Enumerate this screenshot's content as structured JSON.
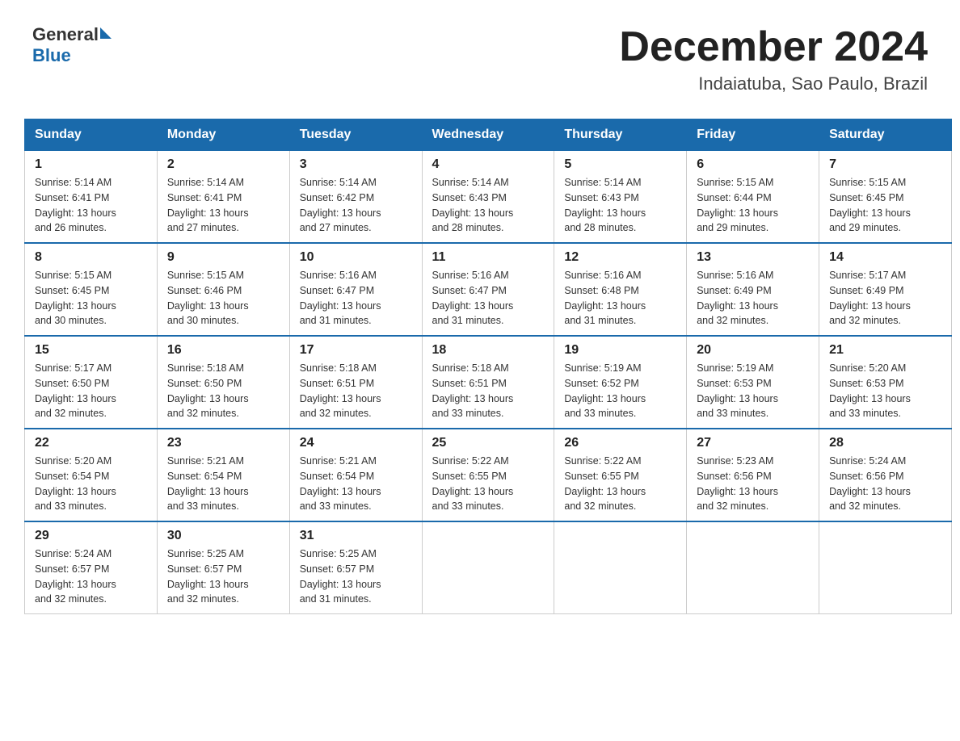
{
  "header": {
    "logo_general": "General",
    "logo_blue": "Blue",
    "month_title": "December 2024",
    "location": "Indaiatuba, Sao Paulo, Brazil"
  },
  "weekdays": [
    "Sunday",
    "Monday",
    "Tuesday",
    "Wednesday",
    "Thursday",
    "Friday",
    "Saturday"
  ],
  "weeks": [
    [
      {
        "day": "1",
        "sunrise": "5:14 AM",
        "sunset": "6:41 PM",
        "daylight": "13 hours and 26 minutes."
      },
      {
        "day": "2",
        "sunrise": "5:14 AM",
        "sunset": "6:41 PM",
        "daylight": "13 hours and 27 minutes."
      },
      {
        "day": "3",
        "sunrise": "5:14 AM",
        "sunset": "6:42 PM",
        "daylight": "13 hours and 27 minutes."
      },
      {
        "day": "4",
        "sunrise": "5:14 AM",
        "sunset": "6:43 PM",
        "daylight": "13 hours and 28 minutes."
      },
      {
        "day": "5",
        "sunrise": "5:14 AM",
        "sunset": "6:43 PM",
        "daylight": "13 hours and 28 minutes."
      },
      {
        "day": "6",
        "sunrise": "5:15 AM",
        "sunset": "6:44 PM",
        "daylight": "13 hours and 29 minutes."
      },
      {
        "day": "7",
        "sunrise": "5:15 AM",
        "sunset": "6:45 PM",
        "daylight": "13 hours and 29 minutes."
      }
    ],
    [
      {
        "day": "8",
        "sunrise": "5:15 AM",
        "sunset": "6:45 PM",
        "daylight": "13 hours and 30 minutes."
      },
      {
        "day": "9",
        "sunrise": "5:15 AM",
        "sunset": "6:46 PM",
        "daylight": "13 hours and 30 minutes."
      },
      {
        "day": "10",
        "sunrise": "5:16 AM",
        "sunset": "6:47 PM",
        "daylight": "13 hours and 31 minutes."
      },
      {
        "day": "11",
        "sunrise": "5:16 AM",
        "sunset": "6:47 PM",
        "daylight": "13 hours and 31 minutes."
      },
      {
        "day": "12",
        "sunrise": "5:16 AM",
        "sunset": "6:48 PM",
        "daylight": "13 hours and 31 minutes."
      },
      {
        "day": "13",
        "sunrise": "5:16 AM",
        "sunset": "6:49 PM",
        "daylight": "13 hours and 32 minutes."
      },
      {
        "day": "14",
        "sunrise": "5:17 AM",
        "sunset": "6:49 PM",
        "daylight": "13 hours and 32 minutes."
      }
    ],
    [
      {
        "day": "15",
        "sunrise": "5:17 AM",
        "sunset": "6:50 PM",
        "daylight": "13 hours and 32 minutes."
      },
      {
        "day": "16",
        "sunrise": "5:18 AM",
        "sunset": "6:50 PM",
        "daylight": "13 hours and 32 minutes."
      },
      {
        "day": "17",
        "sunrise": "5:18 AM",
        "sunset": "6:51 PM",
        "daylight": "13 hours and 32 minutes."
      },
      {
        "day": "18",
        "sunrise": "5:18 AM",
        "sunset": "6:51 PM",
        "daylight": "13 hours and 33 minutes."
      },
      {
        "day": "19",
        "sunrise": "5:19 AM",
        "sunset": "6:52 PM",
        "daylight": "13 hours and 33 minutes."
      },
      {
        "day": "20",
        "sunrise": "5:19 AM",
        "sunset": "6:53 PM",
        "daylight": "13 hours and 33 minutes."
      },
      {
        "day": "21",
        "sunrise": "5:20 AM",
        "sunset": "6:53 PM",
        "daylight": "13 hours and 33 minutes."
      }
    ],
    [
      {
        "day": "22",
        "sunrise": "5:20 AM",
        "sunset": "6:54 PM",
        "daylight": "13 hours and 33 minutes."
      },
      {
        "day": "23",
        "sunrise": "5:21 AM",
        "sunset": "6:54 PM",
        "daylight": "13 hours and 33 minutes."
      },
      {
        "day": "24",
        "sunrise": "5:21 AM",
        "sunset": "6:54 PM",
        "daylight": "13 hours and 33 minutes."
      },
      {
        "day": "25",
        "sunrise": "5:22 AM",
        "sunset": "6:55 PM",
        "daylight": "13 hours and 33 minutes."
      },
      {
        "day": "26",
        "sunrise": "5:22 AM",
        "sunset": "6:55 PM",
        "daylight": "13 hours and 32 minutes."
      },
      {
        "day": "27",
        "sunrise": "5:23 AM",
        "sunset": "6:56 PM",
        "daylight": "13 hours and 32 minutes."
      },
      {
        "day": "28",
        "sunrise": "5:24 AM",
        "sunset": "6:56 PM",
        "daylight": "13 hours and 32 minutes."
      }
    ],
    [
      {
        "day": "29",
        "sunrise": "5:24 AM",
        "sunset": "6:57 PM",
        "daylight": "13 hours and 32 minutes."
      },
      {
        "day": "30",
        "sunrise": "5:25 AM",
        "sunset": "6:57 PM",
        "daylight": "13 hours and 32 minutes."
      },
      {
        "day": "31",
        "sunrise": "5:25 AM",
        "sunset": "6:57 PM",
        "daylight": "13 hours and 31 minutes."
      },
      null,
      null,
      null,
      null
    ]
  ],
  "labels": {
    "sunrise": "Sunrise:",
    "sunset": "Sunset:",
    "daylight": "Daylight:"
  }
}
